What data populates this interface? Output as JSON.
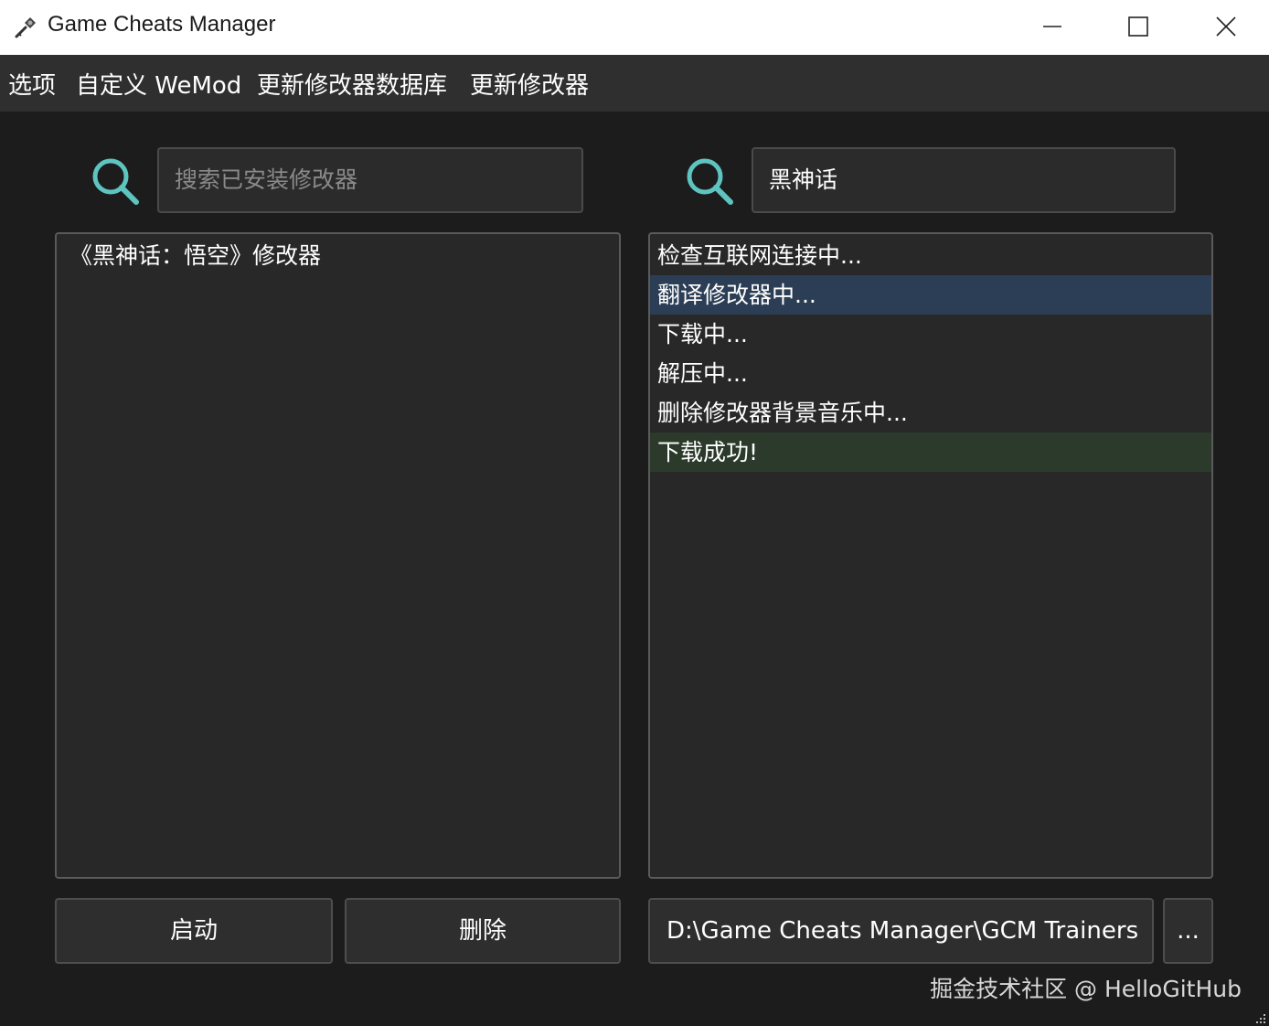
{
  "window": {
    "title": "Game Cheats Manager",
    "icon": "trainer-key-icon",
    "controls": [
      "minimize-icon",
      "maximize-icon",
      "close-icon"
    ]
  },
  "menu": {
    "items": [
      "选项",
      "自定义 WeMod",
      "更新修改器数据库",
      "更新修改器"
    ]
  },
  "installed": {
    "search_placeholder": "搜索已安装修改器",
    "search_value": "",
    "items": [
      "《黑神话：悟空》修改器"
    ]
  },
  "download": {
    "search_value": "黑神话",
    "status_lines": [
      {
        "text": "检查互联网连接中...",
        "state": "normal"
      },
      {
        "text": "翻译修改器中...",
        "state": "selected"
      },
      {
        "text": "下载中...",
        "state": "normal"
      },
      {
        "text": "解压中...",
        "state": "normal"
      },
      {
        "text": "删除修改器背景音乐中...",
        "state": "normal"
      },
      {
        "text": "下载成功!",
        "state": "success"
      }
    ]
  },
  "buttons": {
    "launch": "启动",
    "delete": "删除",
    "browse": "..."
  },
  "path": {
    "value": "D:\\Game Cheats Manager\\GCM Trainers"
  },
  "watermark": "掘金技术社区 @ HelloGitHub",
  "colors": {
    "background": "#1c1c1c",
    "menubar": "#2f2f2f",
    "search_icon": "#5ec4c0",
    "selected_row": "#2c3e55",
    "success_row": "#2b3a2a"
  }
}
